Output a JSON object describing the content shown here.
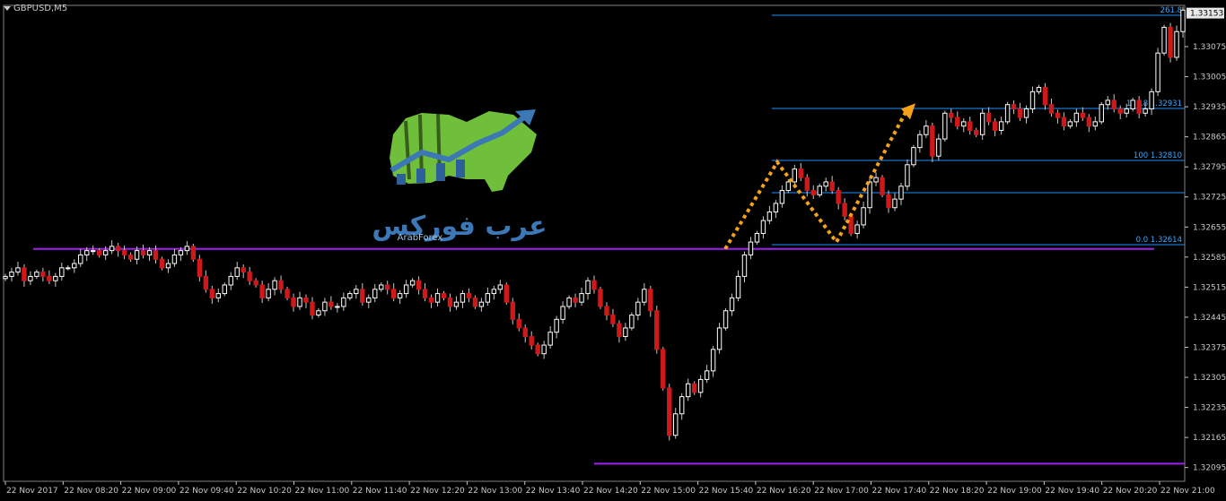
{
  "window": {
    "title": "GBPUSD,M5"
  },
  "logo": {
    "caption": "ArabForex",
    "arabic": "عرب فوركس"
  },
  "colors": {
    "background": "#000000",
    "grid": "#ffffff",
    "bull": "#ffffff",
    "bear": "#d01818",
    "wick": "#c8c8c8",
    "fib": "#1e90ff",
    "fib_label": "#3aa8ff",
    "support": "#a020f0",
    "zigzag": "#f5a21a",
    "axis_text": "#c8c8c8"
  },
  "chart_data": {
    "type": "candlestick",
    "symbol": "GBPUSD",
    "timeframe": "M5",
    "ylim": [
      1.32063,
      1.33171
    ],
    "y_ticks": [
      "1.33075",
      "1.33005",
      "1.32935",
      "1.32865",
      "1.32795",
      "1.32725",
      "1.32655",
      "1.32585",
      "1.32515",
      "1.32445",
      "1.32375",
      "1.32305",
      "1.32235",
      "1.32165",
      "1.32095"
    ],
    "current_price": "1.33153",
    "x_ticks": [
      "22 Nov 2017",
      "22 Nov 08:20",
      "22 Nov 09:00",
      "22 Nov 09:40",
      "22 Nov 10:20",
      "22 Nov 11:00",
      "22 Nov 11:40",
      "22 Nov 12:20",
      "22 Nov 13:00",
      "22 Nov 13:40",
      "22 Nov 14:20",
      "22 Nov 15:00",
      "22 Nov 15:40",
      "22 Nov 16:20",
      "22 Nov 17:00",
      "22 Nov 17:40",
      "22 Nov 18:20",
      "22 Nov 19:00",
      "22 Nov 19:40",
      "22 Nov 20:20",
      "22 Nov 21:00"
    ],
    "candles_closes": [
      1.3254,
      1.3255,
      1.3256,
      1.3253,
      1.3254,
      1.3255,
      1.3254,
      1.3253,
      1.3254,
      1.3256,
      1.3256,
      1.3257,
      1.3259,
      1.326,
      1.326,
      1.3259,
      1.326,
      1.3261,
      1.326,
      1.3259,
      1.3258,
      1.326,
      1.3259,
      1.326,
      1.3258,
      1.3256,
      1.3257,
      1.3259,
      1.326,
      1.3261,
      1.3258,
      1.3254,
      1.3251,
      1.3249,
      1.325,
      1.3252,
      1.3254,
      1.3256,
      1.3255,
      1.3253,
      1.3252,
      1.3249,
      1.3251,
      1.3253,
      1.3251,
      1.3249,
      1.3247,
      1.3249,
      1.3248,
      1.3245,
      1.3246,
      1.3248,
      1.3247,
      1.3247,
      1.3249,
      1.325,
      1.3251,
      1.3248,
      1.3249,
      1.3251,
      1.3252,
      1.3251,
      1.3249,
      1.325,
      1.3252,
      1.3253,
      1.3251,
      1.3249,
      1.3248,
      1.325,
      1.3249,
      1.3247,
      1.3248,
      1.325,
      1.3249,
      1.3247,
      1.3248,
      1.325,
      1.3251,
      1.3252,
      1.3248,
      1.3244,
      1.3242,
      1.324,
      1.3238,
      1.3236,
      1.3238,
      1.3241,
      1.3244,
      1.3247,
      1.3249,
      1.3248,
      1.325,
      1.3253,
      1.3251,
      1.3247,
      1.3245,
      1.3243,
      1.324,
      1.3242,
      1.3245,
      1.3248,
      1.3251,
      1.3246,
      1.3237,
      1.3228,
      1.3217,
      1.3222,
      1.3226,
      1.3229,
      1.3227,
      1.323,
      1.3232,
      1.3237,
      1.3242,
      1.3246,
      1.3249,
      1.3254,
      1.3259,
      1.3262,
      1.3264,
      1.3267,
      1.3269,
      1.3271,
      1.3274,
      1.3276,
      1.3279,
      1.3277,
      1.3274,
      1.3273,
      1.3275,
      1.3276,
      1.3274,
      1.3271,
      1.3268,
      1.3264,
      1.3266,
      1.327,
      1.3276,
      1.3277,
      1.3273,
      1.327,
      1.3272,
      1.3275,
      1.328,
      1.3284,
      1.3287,
      1.3289,
      1.3282,
      1.3286,
      1.3292,
      1.3291,
      1.3289,
      1.329,
      1.3288,
      1.3287,
      1.3292,
      1.329,
      1.3288,
      1.329,
      1.3294,
      1.3293,
      1.3291,
      1.3293,
      1.3297,
      1.3298,
      1.3294,
      1.3292,
      1.3291,
      1.3289,
      1.329,
      1.3292,
      1.3291,
      1.3289,
      1.329,
      1.3294,
      1.3295,
      1.3293,
      1.3292,
      1.3293,
      1.3295,
      1.3292,
      1.3293,
      1.3297,
      1.3306,
      1.3312,
      1.3305,
      1.3311,
      1.3316
    ],
    "fibonacci": [
      {
        "level": "261.8",
        "price": ""
      },
      {
        "level": "161.8",
        "price": "1.32931"
      },
      {
        "level": "100",
        "price": "1.32810"
      },
      {
        "level": "",
        "price": "",
        "value": 1.32735
      },
      {
        "level": "0.0",
        "price": "1.32614"
      }
    ],
    "fib_values": [
      1.33148,
      1.32931,
      1.3281,
      1.32735,
      1.32614
    ],
    "support_lines": [
      1.32604,
      1.32104
    ],
    "zigzag_prices": [
      1.32604,
      1.32806,
      1.3262,
      1.32926
    ]
  }
}
